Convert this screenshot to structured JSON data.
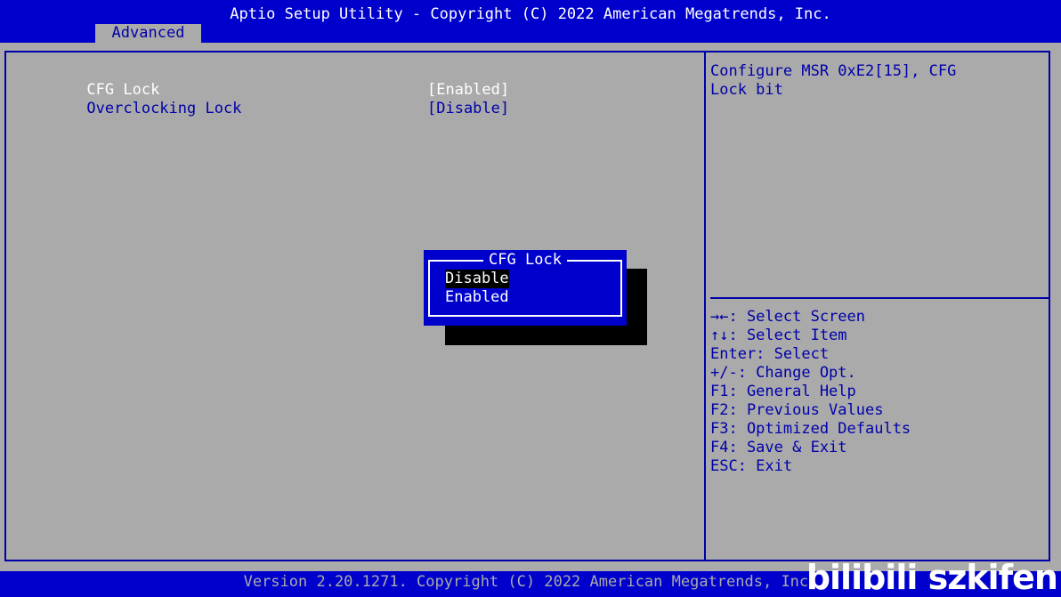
{
  "header": {
    "title": "Aptio Setup Utility - Copyright (C) 2022 American Megatrends, Inc.",
    "active_tab": "Advanced"
  },
  "settings": {
    "items": [
      {
        "label": "CFG Lock",
        "value": "[Enabled]"
      },
      {
        "label": "Overclocking Lock",
        "value": "[Disable]"
      }
    ]
  },
  "help": {
    "text": "Configure MSR 0xE2[15], CFG\nLock bit"
  },
  "key_legend": [
    "→←: Select Screen",
    "↑↓: Select Item",
    "Enter: Select",
    "+/-: Change Opt.",
    "F1: General Help",
    "F2: Previous Values",
    "F3: Optimized Defaults",
    "F4: Save & Exit",
    "ESC: Exit"
  ],
  "popup": {
    "title": "CFG Lock",
    "options": [
      "Disable",
      "Enabled"
    ],
    "highlighted": "Disable"
  },
  "footer": {
    "text": "Version 2.20.1271. Copyright (C) 2022 American Megatrends, Inc."
  },
  "watermark": {
    "text": "bilibili szkifen"
  },
  "colors": {
    "bios_blue": "#0000cc",
    "panel_gray": "#aaaaaa",
    "text_blue": "#0000aa",
    "highlight_white": "#ffffff"
  }
}
